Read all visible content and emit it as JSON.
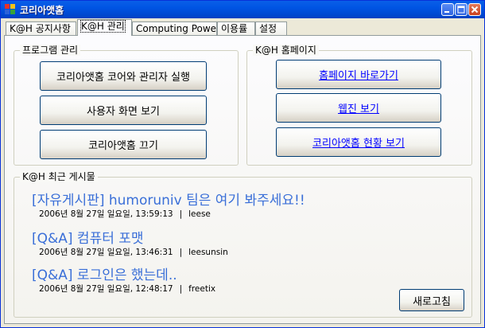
{
  "window": {
    "title": "코리아앳홈"
  },
  "tabs": [
    {
      "label": "K@H 공지사항"
    },
    {
      "label": "K@H 관리"
    },
    {
      "label": "Computing Power"
    },
    {
      "label": "이용률"
    },
    {
      "label": "설정"
    }
  ],
  "program_group": {
    "title": "프로그램 관리",
    "buttons": [
      {
        "label": "코리아앳홈 코어와 관리자 실행"
      },
      {
        "label": "사용자 화면 보기"
      },
      {
        "label": "코리아앳홈 끄기"
      }
    ]
  },
  "homepage_group": {
    "title": "K@H 홈페이지",
    "links": [
      {
        "label": "홈페이지 바로가기"
      },
      {
        "label": "웹진 보기"
      },
      {
        "label": "코리아앳홈 현황 보기"
      }
    ]
  },
  "recent_posts": {
    "title": "K@H 최근 게시물",
    "refresh_label": "새로고침",
    "posts": [
      {
        "title": "[자유게시판] humoruniv 팀은 여기 봐주세요!!",
        "datetime": "2006년 8월 27일 일요일, 13:59:13",
        "separator": "|",
        "author": "leese"
      },
      {
        "title": "[Q&A] 컴퓨터 포맷",
        "datetime": "2006년 8월 27일 일요일, 13:46:31",
        "separator": "|",
        "author": "leesunsin"
      },
      {
        "title": "[Q&A] 로그인은 했는데..",
        "datetime": "2006년 8월 27일 일요일, 12:48:17",
        "separator": "|",
        "author": "freetix"
      }
    ]
  },
  "colors": {
    "titlebar": "#0054E3",
    "link": "#0000FF",
    "post_title": "#3A6FD8"
  },
  "icons": {
    "app": "app-icon",
    "minimize": "minimize-icon",
    "maximize": "maximize-icon",
    "close": "close-icon"
  }
}
